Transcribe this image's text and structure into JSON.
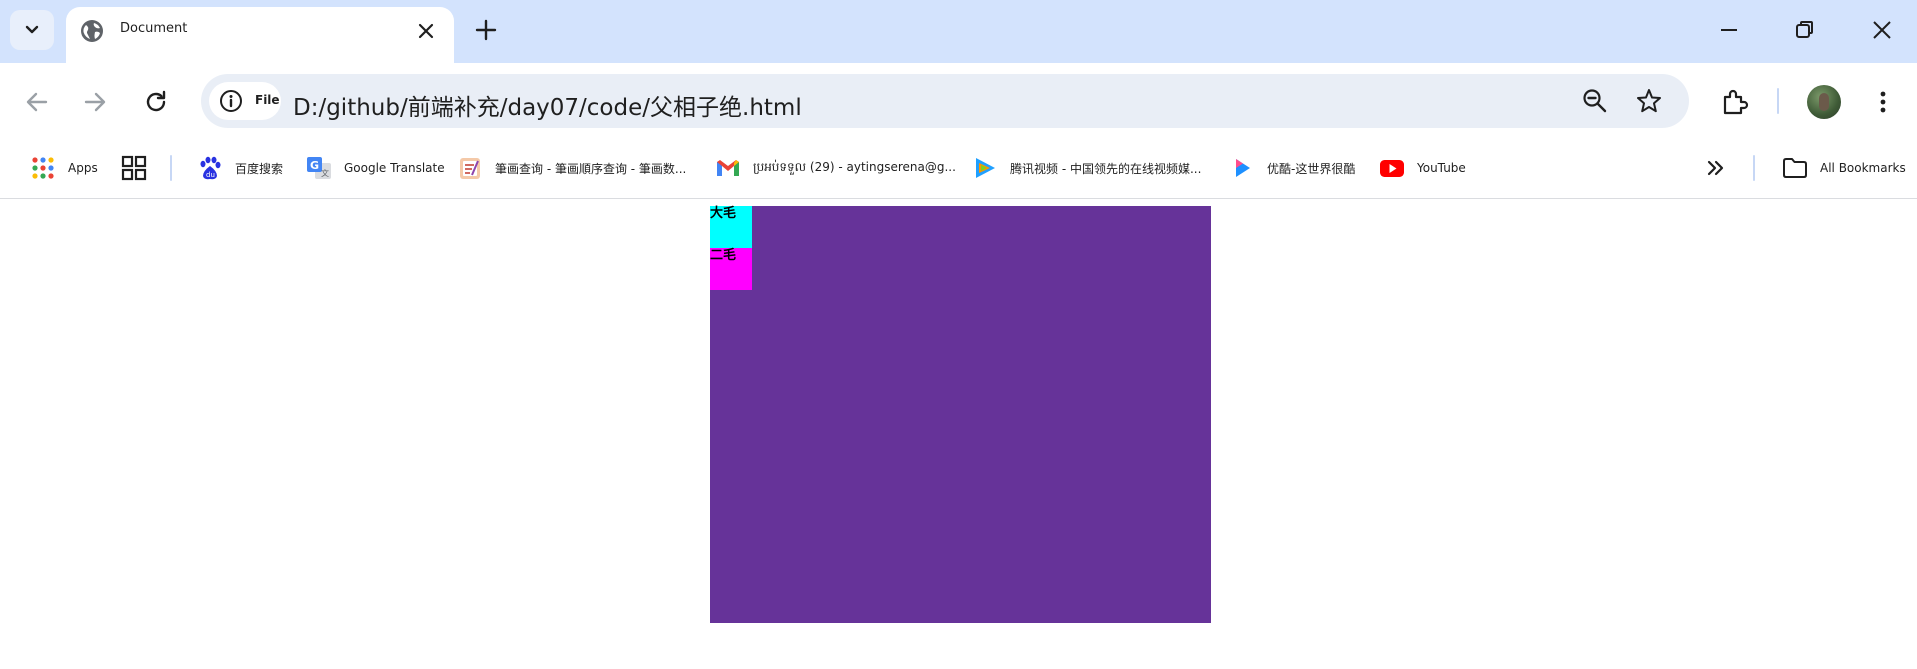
{
  "browser": {
    "tab": {
      "title": "Document",
      "favicon": "globe-icon"
    },
    "omnibox": {
      "site_chip_label": "File",
      "url": "D:/github/前端补充/day07/code/父相子绝.html"
    },
    "bookmarks": [
      {
        "label": "Apps",
        "icon": "apps-grid-icon"
      },
      {
        "label": "",
        "icon": "tab-groups-icon"
      },
      {
        "label": "百度搜索",
        "icon": "baidu-icon"
      },
      {
        "label": "Google Translate",
        "icon": "google-translate-icon"
      },
      {
        "label": "筆画查询 - 筆画順序查询 - 筆画数...",
        "icon": "stroke-order-icon"
      },
      {
        "label": "ប្រអប់ទទួល (29) - aytingserena@g...",
        "icon": "gmail-icon"
      },
      {
        "label": "腾讯视频 - 中国领先的在线视频媒...",
        "icon": "tencent-video-icon"
      },
      {
        "label": "优酷-这世界很酷",
        "icon": "youku-icon"
      },
      {
        "label": "YouTube",
        "icon": "youtube-icon"
      }
    ],
    "all_bookmarks_label": "All Bookmarks"
  },
  "page": {
    "father_color": "#663399",
    "children": [
      {
        "label": "大毛",
        "color": "#00ffff"
      },
      {
        "label": "二毛",
        "color": "#ff00ff"
      }
    ]
  }
}
